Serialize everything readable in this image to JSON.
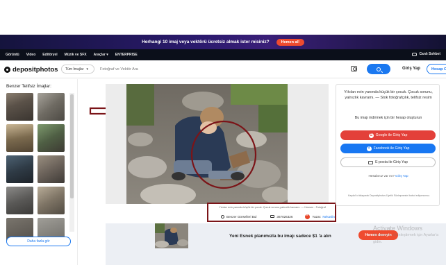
{
  "promo": {
    "text": "Herhangi 10 imaj veya vektörü ücretsiz almak ister misiniz?",
    "cta": "Hemen al!"
  },
  "nav": {
    "items": [
      "Görüntü",
      "Video",
      "Editöryel",
      "Müzik ve SFX",
      "Araçlar",
      "ENTERPRISE"
    ],
    "chat": "Canlı Sohbet"
  },
  "header": {
    "logo": "depositphotos",
    "category": "Tüm İmajlar",
    "search_placeholder": "Fotoğraf ve Vektör Ara",
    "login": "Giriş Yap",
    "signup": "Hesap O"
  },
  "sidebar": {
    "title": "Benzer Telifsiz İmajlar:",
    "more": "Daha fazla gör"
  },
  "photo": {
    "caption": "Yıkılan evin yanında küçük bir çocuk. Çocuk sorunu,yalnızlık kavramı. — Hessen - Fotoğraf",
    "find_similar": "Benzer Görselleri Bul",
    "stock_id": "367026326",
    "author_label": "Yazar:",
    "author_name": "Nekaslin"
  },
  "login_card": {
    "heading": "Yıkılan evin yanında küçük bir çocuk. Çocuk sorunu, yalnızlık kavramı. — Stok fotoğrafçılık, telifsiz resim",
    "sub": "Bu imajı indirmek için bir hesap oluşturun",
    "google": "Google ile Giriş Yap",
    "facebook": "Facebook ile Giriş Yap",
    "email": "E-posta ile Giriş Yap",
    "have_account_prefix": "Hesabınız var mı?",
    "have_account_link": "Giriş Yap",
    "terms": "Kaydol'u tıklayarak Depositphotos Üyelik Sözleşmesini kabul ediyorsunuz."
  },
  "banner": {
    "text": "Yeni Esnek planımızla bu imajı sadece $1 'a alın",
    "cta": "Hemen deneyin"
  },
  "watermark": {
    "title": "Activate Windows",
    "sub": "Windows'u etkinleştirmek için Ayarlar'a gidin."
  },
  "colors": {
    "accent": "#1a78f0",
    "promo_cta": "#ef4b2f",
    "highlight": "#7b1418"
  }
}
